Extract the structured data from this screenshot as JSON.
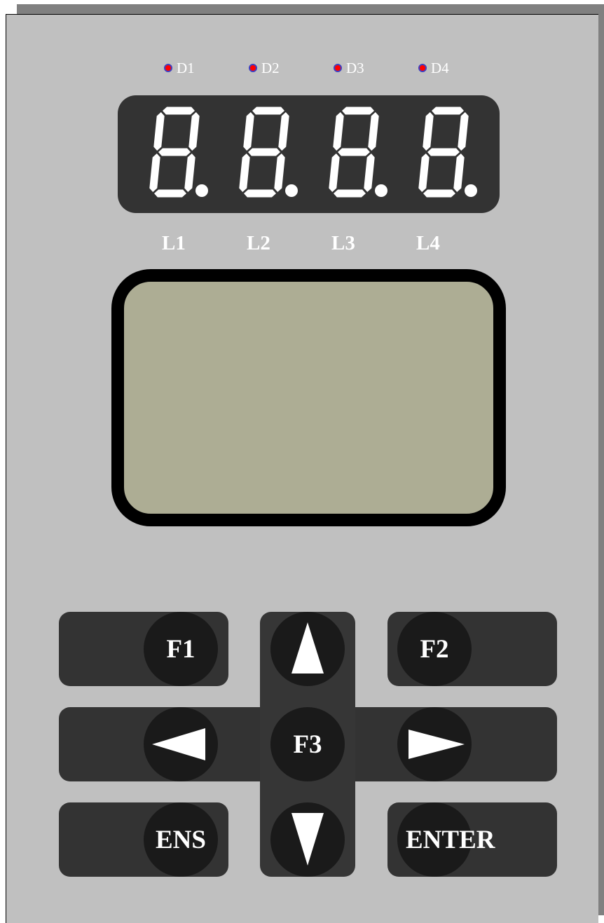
{
  "leds": [
    {
      "label": "D1",
      "color": "#ff0000"
    },
    {
      "label": "D2",
      "color": "#ff0000"
    },
    {
      "label": "D3",
      "color": "#ff0000"
    },
    {
      "label": "D4",
      "color": "#ff0000"
    }
  ],
  "display": {
    "digits": [
      "8.",
      "8.",
      "8.",
      "8."
    ],
    "segment_color": "#ffffff",
    "background_color": "#333333"
  },
  "line_labels": [
    "L1",
    "L2",
    "L3",
    "L4"
  ],
  "lcd": {
    "background_color": "#adad94",
    "text": ""
  },
  "keys": {
    "f1": "F1",
    "f2": "F2",
    "f3": "F3",
    "ens": "ENS",
    "enter": "ENTER",
    "up_icon": "up-arrow-icon",
    "down_icon": "down-arrow-icon",
    "left_icon": "left-arrow-icon",
    "right_icon": "right-arrow-icon"
  }
}
